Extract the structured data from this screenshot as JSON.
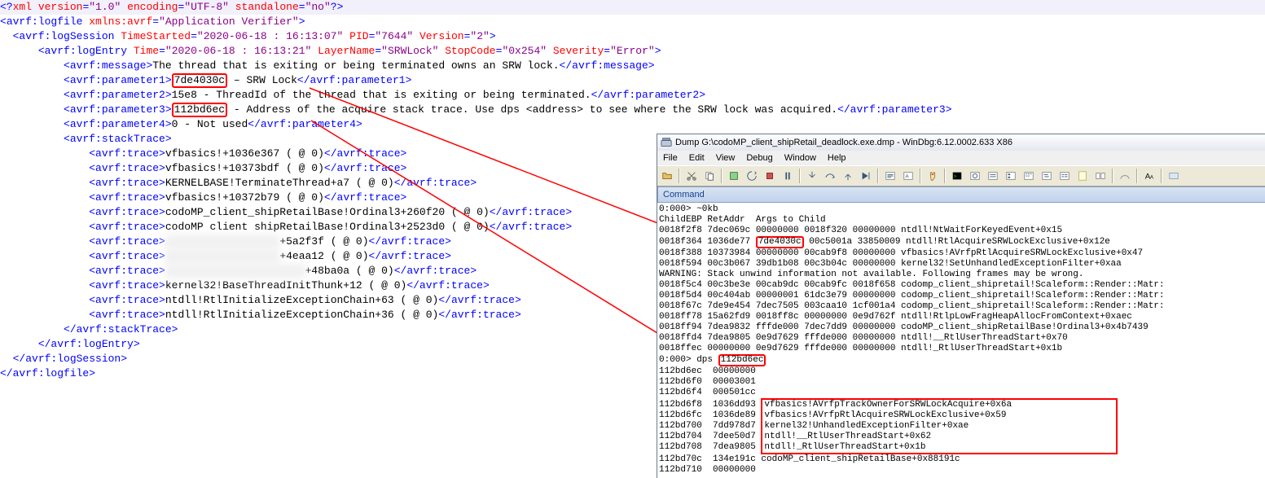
{
  "xml": {
    "pi": {
      "name": "xml",
      "attrs": [
        {
          "n": "version",
          "v": "\"1.0\""
        },
        {
          "n": "encoding",
          "v": "\"UTF-8\""
        },
        {
          "n": "standalone",
          "v": "\"no\""
        }
      ]
    },
    "logfile": {
      "tag": "avrf:logfile",
      "attrs": [
        {
          "n": "xmlns:avrf",
          "v": "\"Application Verifier\""
        }
      ]
    },
    "logSession": {
      "tag": "avrf:logSession",
      "attrs": [
        {
          "n": "TimeStarted",
          "v": "\"2020-06-18 : 16:13:07\""
        },
        {
          "n": "PID",
          "v": "\"7644\""
        },
        {
          "n": "Version",
          "v": "\"2\""
        }
      ]
    },
    "logEntry": {
      "tag": "avrf:logEntry",
      "attrs": [
        {
          "n": "Time",
          "v": "\"2020-06-18 : 16:13:21\""
        },
        {
          "n": "LayerName",
          "v": "\"SRWLock\""
        },
        {
          "n": "StopCode",
          "v": "\"0x254\""
        },
        {
          "n": "Severity",
          "v": "\"Error\""
        }
      ]
    },
    "message": {
      "tag": "avrf:message",
      "text": "The thread that is exiting or being terminated owns an SRW lock."
    },
    "param1": {
      "tag": "avrf:parameter1",
      "val": "7de4030c",
      "suffix": " – SRW Lock"
    },
    "param2": {
      "tag": "avrf:parameter2",
      "text": "15e8 - ThreadId of the thread that is exiting or being terminated."
    },
    "param3": {
      "tag": "avrf:parameter3",
      "val": "112bd6ec",
      "suffix": " - Address of the acquire stack trace. Use dps ",
      "em1": "&lt;",
      "mid": "address",
      "em2": "&gt;",
      "tail": " to see where the SRW lock was acquired."
    },
    "param4": {
      "tag": "avrf:parameter4",
      "text": "0 - Not used"
    },
    "stackTraceTag": "avrf:stackTrace",
    "traceTag": "avrf:trace",
    "traces": [
      {
        "text": "vfbasics!+1036e367 ( @ 0)"
      },
      {
        "text": "vfbasics!+10373bdf ( @ 0)"
      },
      {
        "text": "KERNELBASE!TerminateThread+a7 ( @ 0)"
      },
      {
        "text": "vfbasics!+10372b79 ( @ 0)"
      },
      {
        "text": "codoMP_client_shipRetailBase!Ordinal3+260f20 ( @ 0)"
      },
      {
        "text": "codoMP client shipRetailBase!Ordinal3+2523d0 ( @ 0)"
      },
      {
        "pre": "",
        "cen": "xxxxxxxxxxxxxxxxxx",
        "post": "+5a2f3f ( @ 0)"
      },
      {
        "pre": "",
        "cen": "xxxxxxxxxxxxxxxxxx",
        "post": "+4eaa12 ( @ 0)"
      },
      {
        "pre": "",
        "cen": "xxxxxxxxxxxxxxxxxxxxxx",
        "post": "+48ba0a ( @ 0)"
      },
      {
        "text": "kernel32!BaseThreadInitThunk+12 ( @ 0)"
      },
      {
        "text": "ntdll!RtlInitializeExceptionChain+63 ( @ 0)"
      },
      {
        "text": "ntdll!RtlInitializeExceptionChain+36 ( @ 0)"
      }
    ],
    "closes": {
      "stackTrace": "avrf:stackTrace",
      "logEntry": "avrf:logEntry",
      "logSession": "avrf:logSession",
      "logfile": "avrf:logfile"
    }
  },
  "windbg": {
    "title": "Dump G:\\codoMP_client_shipRetail_deadlock.exe.dmp - WinDbg:6.12.0002.633 X86",
    "menus": [
      "File",
      "Edit",
      "View",
      "Debug",
      "Window",
      "Help"
    ],
    "cmdHeader": "Command",
    "out_lines_pre": [
      "0:000> ~0kb",
      "ChildEBP RetAddr  Args to Child",
      "0018f2f8 7dec069c 00000000 0018f320 00000000 ntdll!NtWaitForKeyedEvent+0x15"
    ],
    "highlight1_prefix": "0018f364 1036de77 ",
    "highlight1_value": "7de4030c",
    "highlight1_suffix": " 00c5001a 33850009 ntdll!RtlAcquireSRWLockExclusive+0x12e",
    "out_lines_mid": [
      "0018f388 10373984 00000000 00cab9f8 00000000 vfbasics!AVrfpRtlAcquireSRWLockExclusive+0x47",
      "0018f594 00c3b067 39db1b08 00c3b04c 00000000 kernel32!SetUnhandledExceptionFilter+0xaa",
      "WARNING: Stack unwind information not available. Following frames may be wrong.",
      "0018f5c4 00c3be3e 00cab9dc 00cab9fc 0018f658 codomp_client_shipretail!Scaleform::Render::Matr:",
      "0018f5d4 00c404ab 00000001 61dc3e79 00000000 codomp_client_shipretail!Scaleform::Render::Matr:",
      "0018f67c 7de9e454 7dec7505 003caa10 1cf001a4 codomp_client_shipretail!Scaleform::Render::Matr:",
      "0018ff78 15a62fd9 0018ff8c 00000000 0e9d762f ntdll!RtlpLowFragHeapAllocFromContext+0xaec",
      "0018ff94 7dea9832 fffde000 7dec7dd9 00000000 codoMP_client_shipRetailBase!Ordinal3+0x4b7439",
      "0018ffd4 7dea9805 0e9d7629 fffde000 00000000 ntdll!__RtlUserThreadStart+0x70",
      "0018ffec 00000000 0e9d7629 fffde000 00000000 ntdll!_RtlUserThreadStart+0x1b"
    ],
    "highlight2_prefix": "0:000> dps ",
    "highlight2_value": "112bd6ec",
    "out_lines_post": [
      "112bd6ec  00000000",
      "112bd6f0  00003001",
      "112bd6f4  000501cc"
    ],
    "boxed_lines": [
      "112bd6f8  1036dd93 vfbasics!AVrfpTrackOwnerForSRWLockAcquire+0x6a",
      "112bd6fc  1036de89 vfbasics!AVrfpRtlAcquireSRWLockExclusive+0x59",
      "112bd700  7dd978d7 kernel32!UnhandledExceptionFilter+0xae",
      "112bd704  7dee50d7 ntdll!__RtlUserThreadStart+0x62",
      "112bd708  7dea9805 ntdll!_RtlUserThreadStart+0x1b"
    ],
    "out_lines_tail": [
      "112bd70c  134e191c codoMP_client_shipRetailBase+0x88191c",
      "112bd710  00000000"
    ]
  }
}
